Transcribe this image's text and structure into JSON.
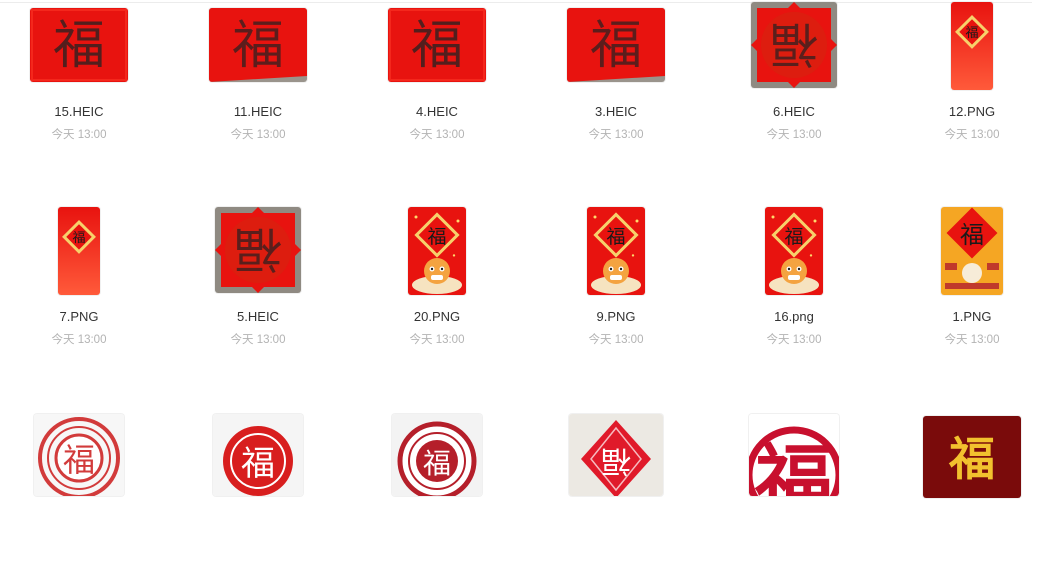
{
  "files": [
    {
      "name": "15.HEIC",
      "date": "今天 13:00",
      "kind": "scroll"
    },
    {
      "name": "11.HEIC",
      "date": "今天 13:00",
      "kind": "scroll-b"
    },
    {
      "name": "4.HEIC",
      "date": "今天 13:00",
      "kind": "scroll"
    },
    {
      "name": "3.HEIC",
      "date": "今天 13:00",
      "kind": "scroll-b"
    },
    {
      "name": "6.HEIC",
      "date": "今天 13:00",
      "kind": "square"
    },
    {
      "name": "12.PNG",
      "date": "今天 13:00",
      "kind": "phone"
    },
    {
      "name": "7.PNG",
      "date": "今天 13:00",
      "kind": "phone"
    },
    {
      "name": "5.HEIC",
      "date": "今天 13:00",
      "kind": "square"
    },
    {
      "name": "20.PNG",
      "date": "今天 13:00",
      "kind": "tiger"
    },
    {
      "name": "9.PNG",
      "date": "今天 13:00",
      "kind": "tiger"
    },
    {
      "name": "16.png",
      "date": "今天 13:00",
      "kind": "tiger"
    },
    {
      "name": "1.PNG",
      "date": "今天 13:00",
      "kind": "poster"
    },
    {
      "name": "",
      "date": "",
      "kind": "seal-circle"
    },
    {
      "name": "",
      "date": "",
      "kind": "seal-red"
    },
    {
      "name": "",
      "date": "",
      "kind": "seal-ring"
    },
    {
      "name": "",
      "date": "",
      "kind": "diamond"
    },
    {
      "name": "",
      "date": "",
      "kind": "big-fu"
    },
    {
      "name": "",
      "date": "",
      "kind": "maroon"
    }
  ],
  "glyphs": {
    "fu": "福"
  },
  "colors": {
    "red": "#e8130f",
    "deepred": "#c8102e",
    "maroon": "#7a0b0b",
    "gold": "#f2c12e",
    "orange": "#f5a623"
  }
}
